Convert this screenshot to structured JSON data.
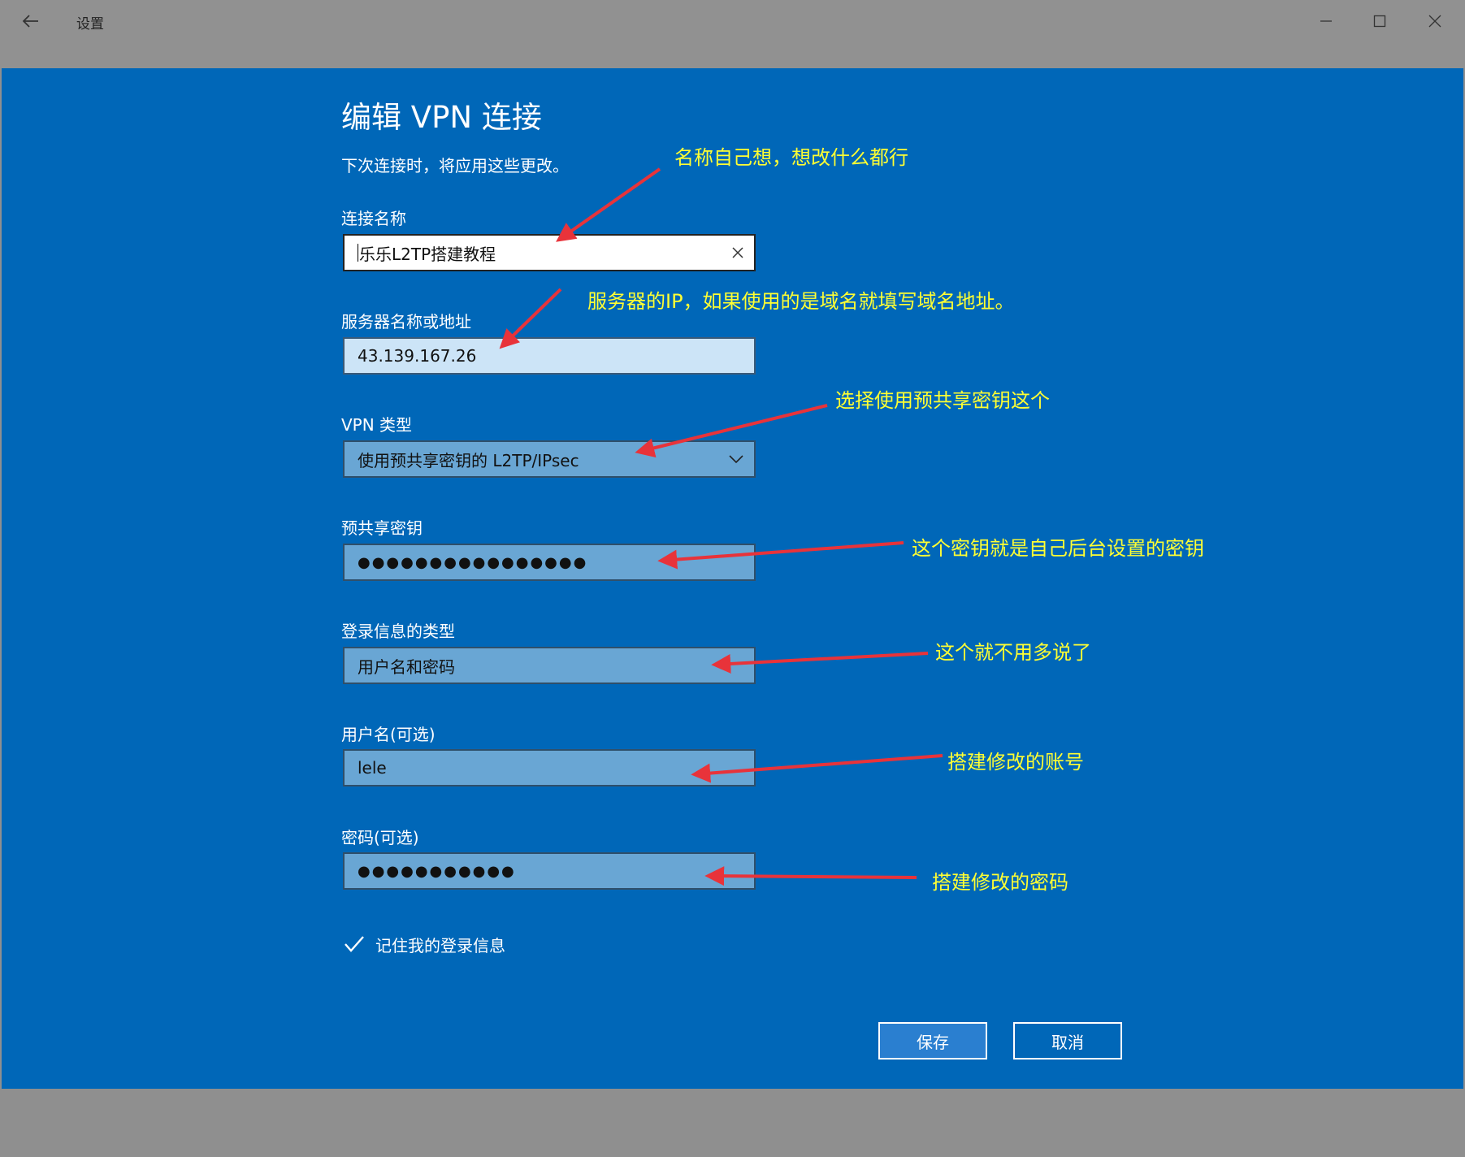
{
  "window": {
    "title": "设置"
  },
  "page": {
    "heading": "编辑 VPN 连接",
    "subtitle": "下次连接时，将应用这些更改。"
  },
  "form": {
    "connection_name": {
      "label": "连接名称",
      "value": "乐乐L2TP搭建教程"
    },
    "server": {
      "label": "服务器名称或地址",
      "value": "43.139.167.26"
    },
    "vpn_type": {
      "label": "VPN 类型",
      "value": "使用预共享密钥的 L2TP/IPsec"
    },
    "psk": {
      "label": "预共享密钥",
      "value": "●●●●●●●●●●●●●●●●"
    },
    "signin_type": {
      "label": "登录信息的类型",
      "value": "用户名和密码"
    },
    "username": {
      "label": "用户名(可选)",
      "value": "lele"
    },
    "password": {
      "label": "密码(可选)",
      "value": "●●●●●●●●●●●"
    },
    "remember": {
      "label": "记住我的登录信息",
      "checked": true
    }
  },
  "buttons": {
    "save": "保存",
    "cancel": "取消"
  },
  "annotations": {
    "name": "名称自己想，想改什么都行",
    "server": "服务器的IP，如果使用的是域名就填写域名地址。",
    "vpn_type": "选择使用预共享密钥这个",
    "psk": "这个密钥就是自己后台设置的密钥",
    "signin": "这个就不用多说了",
    "username": "搭建修改的账号",
    "password": "搭建修改的密码"
  },
  "colors": {
    "accent": "#0067b8",
    "annotation_text": "#ffff33",
    "arrow": "#e8333a"
  },
  "icons": [
    "back-arrow-icon",
    "minimize-icon",
    "maximize-icon",
    "close-icon",
    "clear-icon",
    "chevron-down-icon",
    "checkmark-icon"
  ]
}
